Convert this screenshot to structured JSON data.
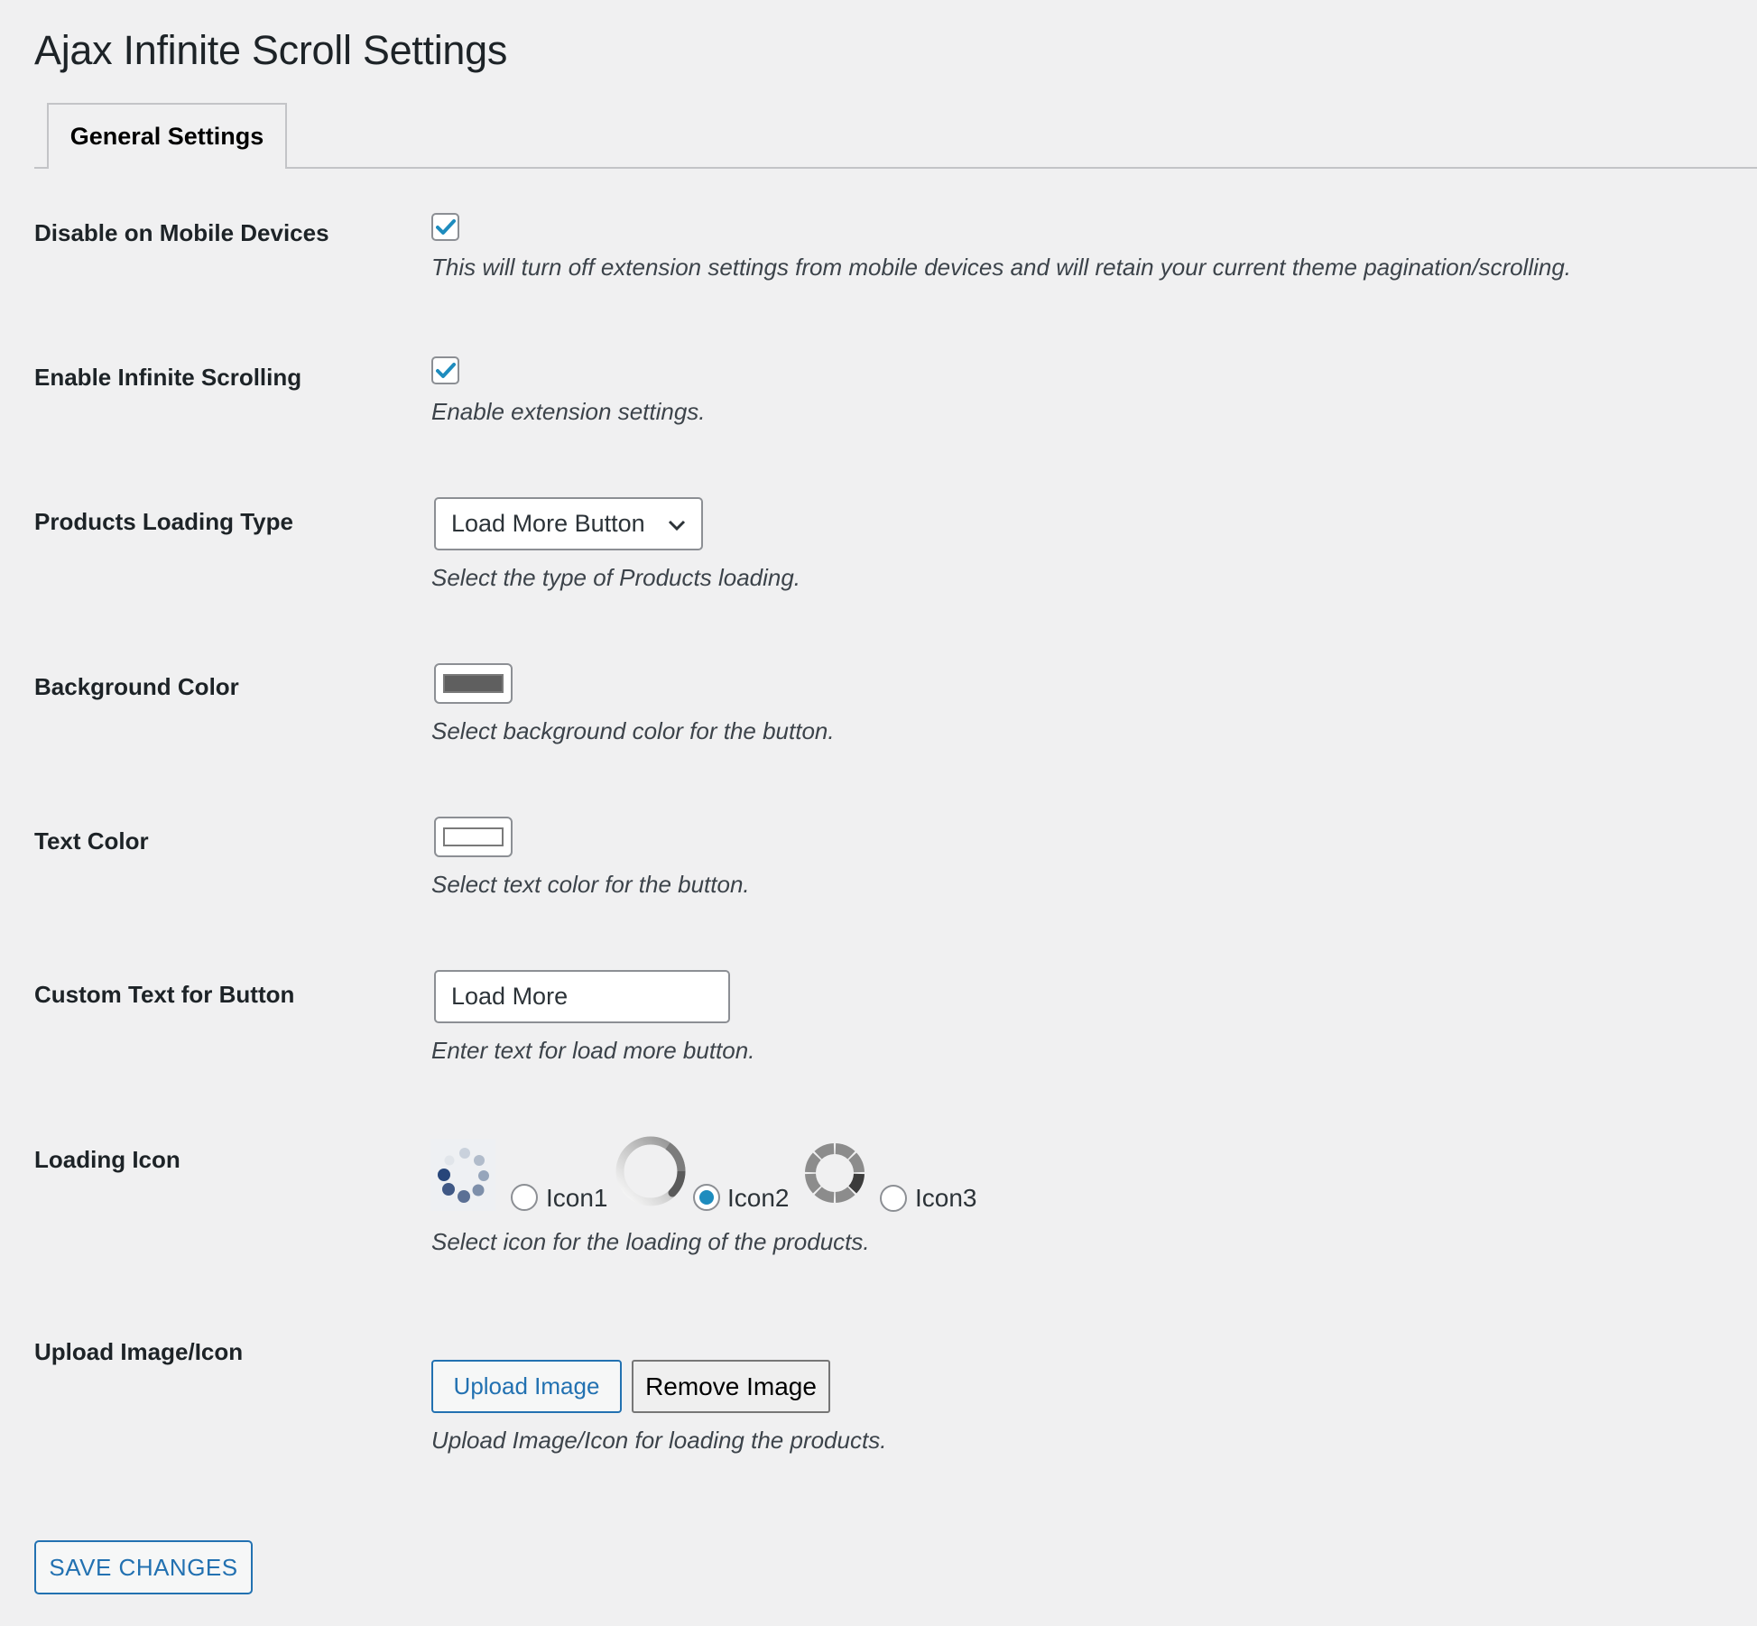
{
  "page": {
    "title": "Ajax Infinite Scroll Settings",
    "tabs": [
      {
        "label": "General Settings",
        "active": true
      }
    ]
  },
  "settings": {
    "disable_mobile": {
      "label": "Disable on Mobile Devices",
      "checked": true,
      "description": "This will turn off extension settings from mobile devices and will retain your current theme pagination/scrolling."
    },
    "enable_infinite": {
      "label": "Enable Infinite Scrolling",
      "checked": true,
      "description": "Enable extension settings."
    },
    "loading_type": {
      "label": "Products Loading Type",
      "selected": "Load More Button",
      "description": "Select the type of Products loading."
    },
    "background_color": {
      "label": "Background Color",
      "value": "#5f5f5f",
      "description": "Select background color for the button."
    },
    "text_color": {
      "label": "Text Color",
      "value": "#ffffff",
      "description": "Select text color for the button."
    },
    "custom_text": {
      "label": "Custom Text for Button",
      "value": "Load More",
      "description": "Enter text for load more button."
    },
    "loading_icon": {
      "label": "Loading Icon",
      "options": [
        {
          "label": "Icon1",
          "icon": "dots-spinner-icon",
          "checked": false
        },
        {
          "label": "Icon2",
          "icon": "ring-spinner-icon",
          "checked": true
        },
        {
          "label": "Icon3",
          "icon": "segmented-ring-spinner-icon",
          "checked": false
        }
      ],
      "description": "Select icon for the loading of the products."
    },
    "upload_image": {
      "label": "Upload Image/Icon",
      "upload_button": "Upload Image",
      "remove_button": "Remove Image",
      "description": "Upload Image/Icon for loading the products."
    }
  },
  "actions": {
    "save_label": "SAVE CHANGES"
  },
  "colors": {
    "accent": "#2271b1",
    "radio_checked": "#1e8cbe",
    "background": "#f0f0f1"
  }
}
